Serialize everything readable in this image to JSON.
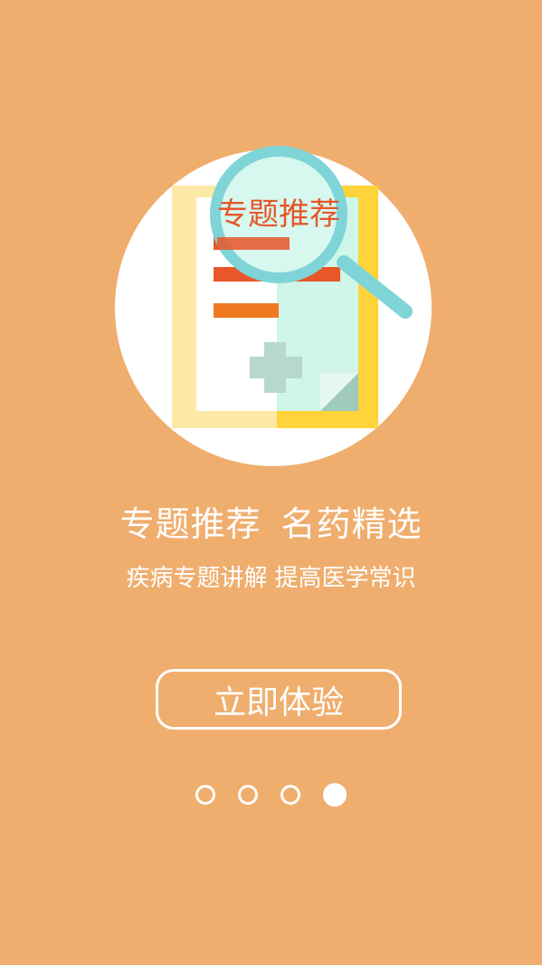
{
  "theme": {
    "background": "#EFAE6E",
    "accent_text": "#E8562A",
    "white": "#FFFFFF"
  },
  "illustration": {
    "magnifier_label": "专题推荐",
    "icons": [
      "document-icon",
      "magnifier-icon",
      "medical-cross-icon"
    ]
  },
  "headline": {
    "part1": "专题推荐",
    "part2": "名药精选"
  },
  "subline": {
    "part1": "疾病专题讲解",
    "part2": "提高医学常识"
  },
  "cta": {
    "label": "立即体验"
  },
  "pager": {
    "total": 4,
    "active_index": 3
  }
}
